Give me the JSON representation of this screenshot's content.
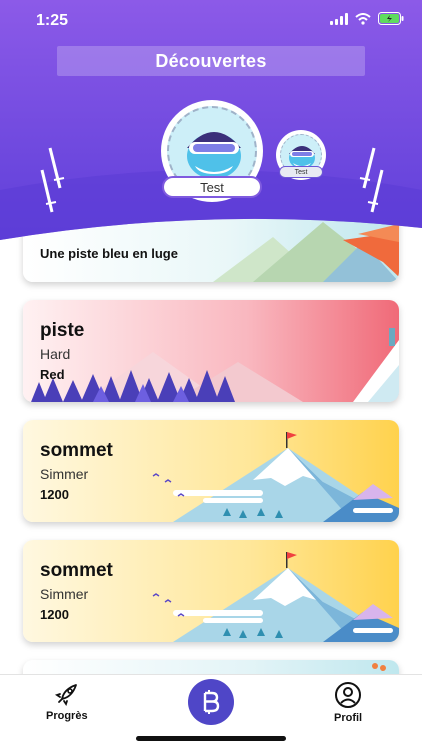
{
  "status": {
    "time": "1:25"
  },
  "header": {
    "title": "Découvertes",
    "player_name": "Test",
    "secondary_name": "Test"
  },
  "cards": [
    {
      "title": "",
      "subtitle": "",
      "value": "Une piste bleu en luge"
    },
    {
      "title": "piste",
      "subtitle": "Hard",
      "value": "Red"
    },
    {
      "title": "sommet",
      "subtitle": "Simmer",
      "value": "1200"
    },
    {
      "title": "sommet",
      "subtitle": "Simmer",
      "value": "1200"
    }
  ],
  "tabs": {
    "progress": "Progrès",
    "profile": "Profil"
  },
  "colors": {
    "header_top": "#8c5ae8",
    "header_bottom": "#5e3fd9",
    "accent": "#4f46c7"
  },
  "icons": {
    "progress": "rocket-icon",
    "center": "bitcoin-b-icon",
    "profile": "user-circle-icon"
  }
}
